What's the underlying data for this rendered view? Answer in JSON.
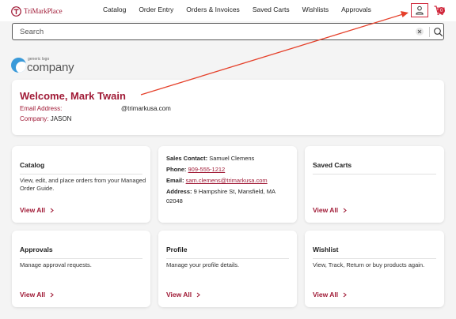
{
  "header": {
    "brand": "TriMarkPlace",
    "nav": [
      "Catalog",
      "Order Entry",
      "Orders & Invoices",
      "Saved Carts",
      "Wishlists",
      "Approvals"
    ],
    "cart_count": "0"
  },
  "search": {
    "placeholder": "Search"
  },
  "logo": {
    "small_text": "generic logo",
    "word": "company"
  },
  "welcome": {
    "title": "Welcome, Mark Twain",
    "email_label": "Email Address:",
    "email_value": "@trimarkusa.com",
    "company_label": "Company:",
    "company_value": "JASON"
  },
  "tiles": {
    "catalog": {
      "title": "Catalog",
      "desc": "View, edit, and place orders from your Managed Order Guide.",
      "link": "View All"
    },
    "contact": {
      "sales_label": "Sales Contact:",
      "sales_value": "Samuel Clemens",
      "phone_label": "Phone:",
      "phone_value": "909-555-1212",
      "email_label": "Email:",
      "email_value": "sam.clemens@trimarkusa.com",
      "address_label": "Address:",
      "address_value": "9 Hampshire St, Mansfield, MA 02048"
    },
    "saved_carts": {
      "title": "Saved Carts",
      "link": "View All"
    },
    "approvals": {
      "title": "Approvals",
      "desc": "Manage approval requests.",
      "link": "View All"
    },
    "profile": {
      "title": "Profile",
      "desc": "Manage your profile details.",
      "link": "View All"
    },
    "wishlist": {
      "title": "Wishlist",
      "desc": "View, Track, Return or buy products again.",
      "link": "View All"
    }
  },
  "colors": {
    "accent": "#a01a36",
    "highlight": "#d0263b",
    "arrow": "#e5402a"
  },
  "icons": [
    "trimark-logo-icon",
    "user-icon",
    "cart-icon",
    "clear-icon",
    "search-icon",
    "chevron-right-icon"
  ]
}
